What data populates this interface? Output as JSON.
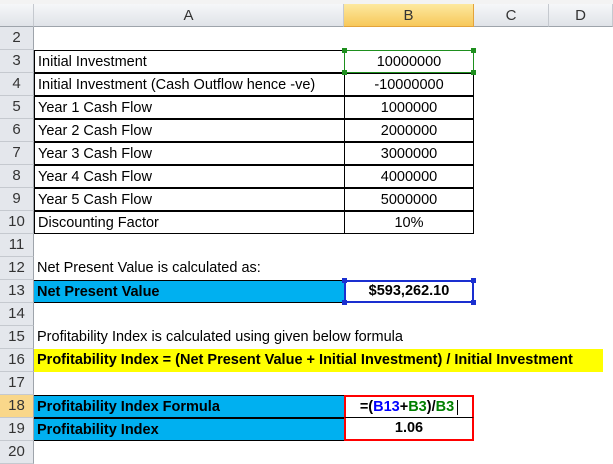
{
  "columns": [
    "A",
    "B",
    "C",
    "D"
  ],
  "rows": [
    {
      "num": "2",
      "a": "",
      "b": ""
    },
    {
      "num": "3",
      "a": "Initial Investment",
      "b": "10000000"
    },
    {
      "num": "4",
      "a": "Initial Investment (Cash Outflow hence -ve)",
      "b": "-10000000"
    },
    {
      "num": "5",
      "a": "Year 1 Cash Flow",
      "b": "1000000"
    },
    {
      "num": "6",
      "a": "Year 2 Cash Flow",
      "b": "2000000"
    },
    {
      "num": "7",
      "a": "Year 3 Cash Flow",
      "b": "3000000"
    },
    {
      "num": "8",
      "a": "Year 4 Cash Flow",
      "b": "4000000"
    },
    {
      "num": "9",
      "a": "Year 5 Cash Flow",
      "b": "5000000"
    },
    {
      "num": "10",
      "a": "Discounting Factor",
      "b": "10%"
    },
    {
      "num": "11",
      "a": "",
      "b": ""
    },
    {
      "num": "12",
      "a": "Net Present Value is calculated as:",
      "b": ""
    },
    {
      "num": "13",
      "a": "Net Present Value",
      "b": "$593,262.10"
    },
    {
      "num": "14",
      "a": "",
      "b": ""
    },
    {
      "num": "15",
      "a": "Profitability Index is calculated using given below formula",
      "b": ""
    },
    {
      "num": "16",
      "a": "Profitability Index = (Net Present Value + Initial Investment) / Initial Investment",
      "b": ""
    },
    {
      "num": "17",
      "a": "",
      "b": ""
    },
    {
      "num": "18",
      "a": "Profitability Index Formula",
      "b": ""
    },
    {
      "num": "19",
      "a": "Profitability Index",
      "b": "1.06"
    },
    {
      "num": "20",
      "a": "",
      "b": ""
    }
  ],
  "formula": {
    "p1": "=(",
    "r1": "B13",
    "plus": "+",
    "r2": "B3",
    "p2": ")/",
    "r3": "B3"
  },
  "colors": {
    "ref1": "#0000ff",
    "ref2": "#008000",
    "highlight": "#00b0f0",
    "yellow": "#ffff00",
    "red": "#ff0000"
  }
}
